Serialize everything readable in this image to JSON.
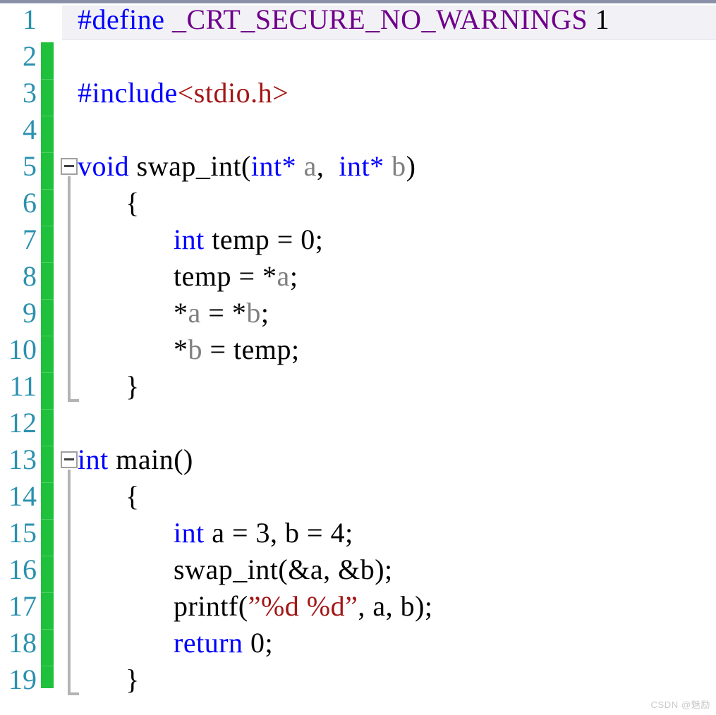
{
  "editor": {
    "app": "visual-studio-code-editor",
    "language": "c",
    "colors": {
      "background": "#ffffff",
      "line_number": "#2b91af",
      "change_bar_saved": "#1fc13c",
      "current_line_highlight": "#f2f2f6",
      "keyword": "#0000ff",
      "macro": "#6f008a",
      "string": "#a31515",
      "parameter": "#808080",
      "plain_text": "#000000",
      "fold_guide": "#b4b4b4",
      "top_chrome": "#8a8fa8"
    },
    "first_line_number": 1,
    "last_line_number": 19,
    "line_height_px": 52
  },
  "gutter": {
    "line_numbers": [
      "1",
      "2",
      "3",
      "4",
      "5",
      "6",
      "7",
      "8",
      "9",
      "10",
      "11",
      "12",
      "13",
      "14",
      "15",
      "16",
      "17",
      "18",
      "19"
    ],
    "fold_markers": [
      {
        "line": 5,
        "state": "expanded",
        "glyph": "minus"
      },
      {
        "line": 13,
        "state": "expanded",
        "glyph": "minus"
      }
    ]
  },
  "code": {
    "lines": [
      {
        "number": "1",
        "highlighted": true,
        "indent": 0,
        "tokens": [
          {
            "text": "#define",
            "kind": "pp"
          },
          {
            "text": " ",
            "kind": "plain"
          },
          {
            "text": "_CRT_SECURE_NO_WARNINGS",
            "kind": "macro"
          },
          {
            "text": " 1",
            "kind": "plain"
          }
        ]
      },
      {
        "number": "2",
        "highlighted": false,
        "indent": 0,
        "tokens": []
      },
      {
        "number": "3",
        "highlighted": false,
        "indent": 0,
        "tokens": [
          {
            "text": "#include",
            "kind": "pp"
          },
          {
            "text": "<stdio.h>",
            "kind": "header"
          }
        ]
      },
      {
        "number": "4",
        "highlighted": false,
        "indent": 0,
        "tokens": []
      },
      {
        "number": "5",
        "highlighted": false,
        "indent": 0,
        "tokens": [
          {
            "text": "void",
            "kind": "kw"
          },
          {
            "text": " swap_int(",
            "kind": "plain"
          },
          {
            "text": "int*",
            "kind": "kw"
          },
          {
            "text": " ",
            "kind": "plain"
          },
          {
            "text": "a",
            "kind": "param"
          },
          {
            "text": ",  ",
            "kind": "plain"
          },
          {
            "text": "int*",
            "kind": "kw"
          },
          {
            "text": " ",
            "kind": "plain"
          },
          {
            "text": "b",
            "kind": "param"
          },
          {
            "text": ")",
            "kind": "plain"
          }
        ]
      },
      {
        "number": "6",
        "highlighted": false,
        "indent": 1,
        "tokens": [
          {
            "text": "{",
            "kind": "plain"
          }
        ]
      },
      {
        "number": "7",
        "highlighted": false,
        "indent": 2,
        "tokens": [
          {
            "text": "int",
            "kind": "kw"
          },
          {
            "text": " temp = 0;",
            "kind": "plain"
          }
        ]
      },
      {
        "number": "8",
        "highlighted": false,
        "indent": 2,
        "tokens": [
          {
            "text": "temp = *",
            "kind": "plain"
          },
          {
            "text": "a",
            "kind": "param"
          },
          {
            "text": ";",
            "kind": "plain"
          }
        ]
      },
      {
        "number": "9",
        "highlighted": false,
        "indent": 2,
        "tokens": [
          {
            "text": "*",
            "kind": "plain"
          },
          {
            "text": "a",
            "kind": "param"
          },
          {
            "text": " = *",
            "kind": "plain"
          },
          {
            "text": "b",
            "kind": "param"
          },
          {
            "text": ";",
            "kind": "plain"
          }
        ]
      },
      {
        "number": "10",
        "highlighted": false,
        "indent": 2,
        "tokens": [
          {
            "text": "*",
            "kind": "plain"
          },
          {
            "text": "b",
            "kind": "param"
          },
          {
            "text": " = temp;",
            "kind": "plain"
          }
        ]
      },
      {
        "number": "11",
        "highlighted": false,
        "indent": 1,
        "tokens": [
          {
            "text": "}",
            "kind": "plain"
          }
        ]
      },
      {
        "number": "12",
        "highlighted": false,
        "indent": 0,
        "tokens": []
      },
      {
        "number": "13",
        "highlighted": false,
        "indent": 0,
        "tokens": [
          {
            "text": "int",
            "kind": "kw"
          },
          {
            "text": " main()",
            "kind": "plain"
          }
        ]
      },
      {
        "number": "14",
        "highlighted": false,
        "indent": 1,
        "tokens": [
          {
            "text": "{",
            "kind": "plain"
          }
        ]
      },
      {
        "number": "15",
        "highlighted": false,
        "indent": 2,
        "tokens": [
          {
            "text": "int",
            "kind": "kw"
          },
          {
            "text": " a = 3, b = 4;",
            "kind": "plain"
          }
        ]
      },
      {
        "number": "16",
        "highlighted": false,
        "indent": 2,
        "tokens": [
          {
            "text": "swap_int(&a, &b);",
            "kind": "plain"
          }
        ]
      },
      {
        "number": "17",
        "highlighted": false,
        "indent": 2,
        "tokens": [
          {
            "text": "printf(",
            "kind": "plain"
          },
          {
            "text": "”%d %d”",
            "kind": "str"
          },
          {
            "text": ", a, b);",
            "kind": "plain"
          }
        ]
      },
      {
        "number": "18",
        "highlighted": false,
        "indent": 2,
        "tokens": [
          {
            "text": "return",
            "kind": "kw"
          },
          {
            "text": " 0;",
            "kind": "plain"
          }
        ]
      },
      {
        "number": "19",
        "highlighted": false,
        "indent": 1,
        "tokens": [
          {
            "text": "}",
            "kind": "plain"
          }
        ]
      }
    ]
  },
  "watermark": {
    "text": "CSDN @魅励"
  }
}
